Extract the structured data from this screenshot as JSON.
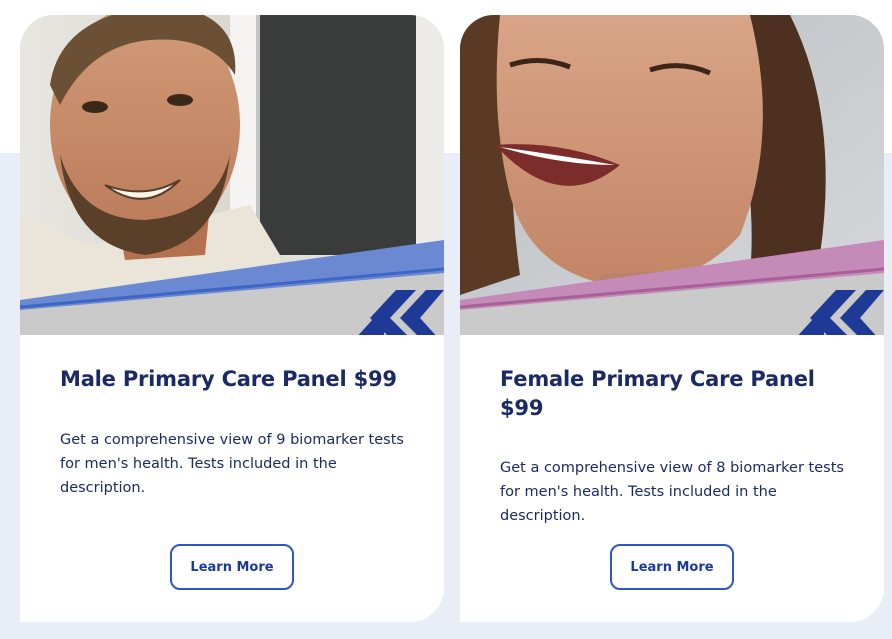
{
  "products": [
    {
      "title": "Male Primary Care Panel $99",
      "description": "Get a comprehensive view of 9 biomarker tests for men's health. Tests included in the description.",
      "button_label": "Learn More",
      "accent_color": "#6a89d2",
      "photo": "smiling-bearded-man-photo"
    },
    {
      "title": "Female Primary Care Panel $99",
      "description": "Get a comprehensive view of 8 biomarker tests for men's health. Tests included in the description.",
      "button_label": "Learn More",
      "accent_color": "#c48ab8",
      "photo": "laughing-woman-photo"
    }
  ],
  "colors": {
    "page_band": "#e9edf8",
    "title_text": "#1b2a64",
    "button_border": "#2f55c8",
    "chevron": "#1e3a96"
  }
}
